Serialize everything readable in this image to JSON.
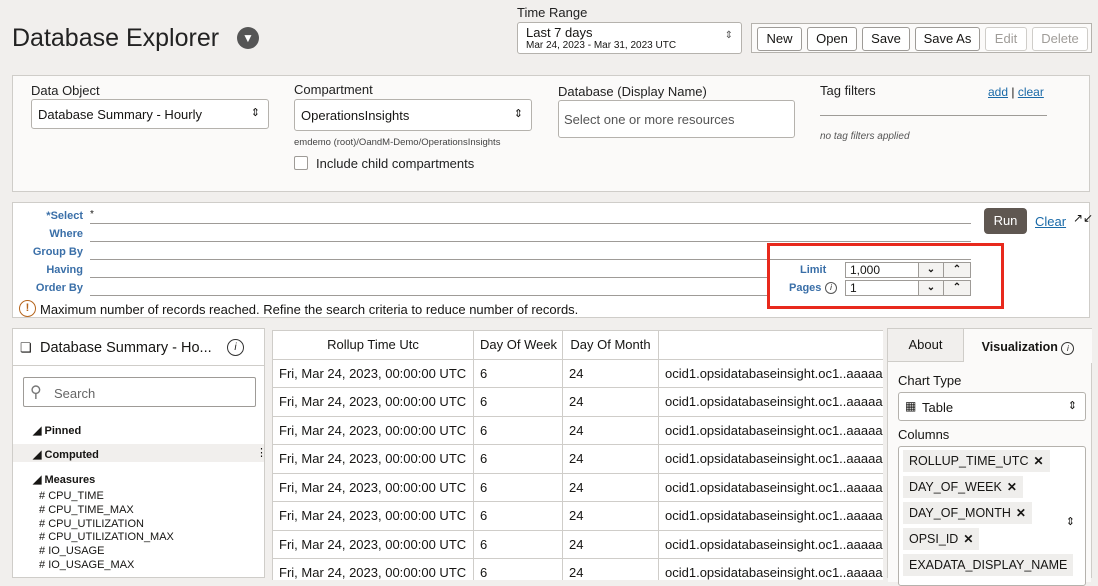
{
  "header": {
    "title": "Database Explorer",
    "time_range_label": "Time Range",
    "time_range_value": "Last 7 days",
    "time_range_dates": "Mar 24, 2023 - Mar 31, 2023 UTC",
    "buttons": {
      "new": "New",
      "open": "Open",
      "save": "Save",
      "save_as": "Save As",
      "edit": "Edit",
      "delete": "Delete"
    }
  },
  "filters": {
    "data_object_label": "Data Object",
    "data_object_value": "Database Summary - Hourly",
    "compartment_label": "Compartment",
    "compartment_value": "OperationsInsights",
    "compartment_path": "emdemo (root)/OandM-Demo/OperationsInsights",
    "include_child": "Include child compartments",
    "database_label": "Database (Display Name)",
    "database_placeholder": "Select one or more resources",
    "tag_label": "Tag filters",
    "tag_add": "add",
    "tag_sep": "|",
    "tag_clear": "clear",
    "tag_empty": "no tag filters applied"
  },
  "query": {
    "select_label": "*Select",
    "select_value": "*",
    "where_label": "Where",
    "groupby_label": "Group By",
    "having_label": "Having",
    "orderby_label": "Order By",
    "run": "Run",
    "clear": "Clear",
    "limit_label": "Limit",
    "limit_value": "1,000",
    "pages_label": "Pages",
    "pages_value": "1",
    "warning": "Maximum number of records reached. Refine the search criteria to reduce number of records."
  },
  "sidebar": {
    "title": "Database Summary - Ho...",
    "search_placeholder": "Search",
    "pinned": "Pinned",
    "computed": "Computed",
    "measures": "Measures",
    "measure_items": [
      "CPU_TIME",
      "CPU_TIME_MAX",
      "CPU_UTILIZATION",
      "CPU_UTILIZATION_MAX",
      "IO_USAGE",
      "IO_USAGE_MAX"
    ]
  },
  "table": {
    "columns": [
      "Rollup Time Utc",
      "Day Of Week",
      "Day Of Month",
      ""
    ],
    "rows": [
      [
        "Fri, Mar 24, 2023, 00:00:00 UTC",
        "6",
        "24",
        "ocid1.opsidatabaseinsight.oc1..aaaaaa"
      ],
      [
        "Fri, Mar 24, 2023, 00:00:00 UTC",
        "6",
        "24",
        "ocid1.opsidatabaseinsight.oc1..aaaaaa"
      ],
      [
        "Fri, Mar 24, 2023, 00:00:00 UTC",
        "6",
        "24",
        "ocid1.opsidatabaseinsight.oc1..aaaaaa"
      ],
      [
        "Fri, Mar 24, 2023, 00:00:00 UTC",
        "6",
        "24",
        "ocid1.opsidatabaseinsight.oc1..aaaaaa"
      ],
      [
        "Fri, Mar 24, 2023, 00:00:00 UTC",
        "6",
        "24",
        "ocid1.opsidatabaseinsight.oc1..aaaaaa"
      ],
      [
        "Fri, Mar 24, 2023, 00:00:00 UTC",
        "6",
        "24",
        "ocid1.opsidatabaseinsight.oc1..aaaaaa"
      ],
      [
        "Fri, Mar 24, 2023, 00:00:00 UTC",
        "6",
        "24",
        "ocid1.opsidatabaseinsight.oc1..aaaaaa"
      ],
      [
        "Fri, Mar 24, 2023, 00:00:00 UTC",
        "6",
        "24",
        "ocid1.opsidatabaseinsight.oc1..aaaaaa"
      ]
    ]
  },
  "right": {
    "tab_about": "About",
    "tab_visualization": "Visualization",
    "chart_type_label": "Chart Type",
    "chart_type_value": "Table",
    "columns_label": "Columns",
    "column_chips": [
      "ROLLUP_TIME_UTC",
      "DAY_OF_WEEK",
      "DAY_OF_MONTH",
      "OPSI_ID",
      "EXADATA_DISPLAY_NAME"
    ]
  },
  "colors": {
    "accent": "#3a6fa8",
    "highlight": "#e8291c",
    "run": "#5f5751"
  }
}
